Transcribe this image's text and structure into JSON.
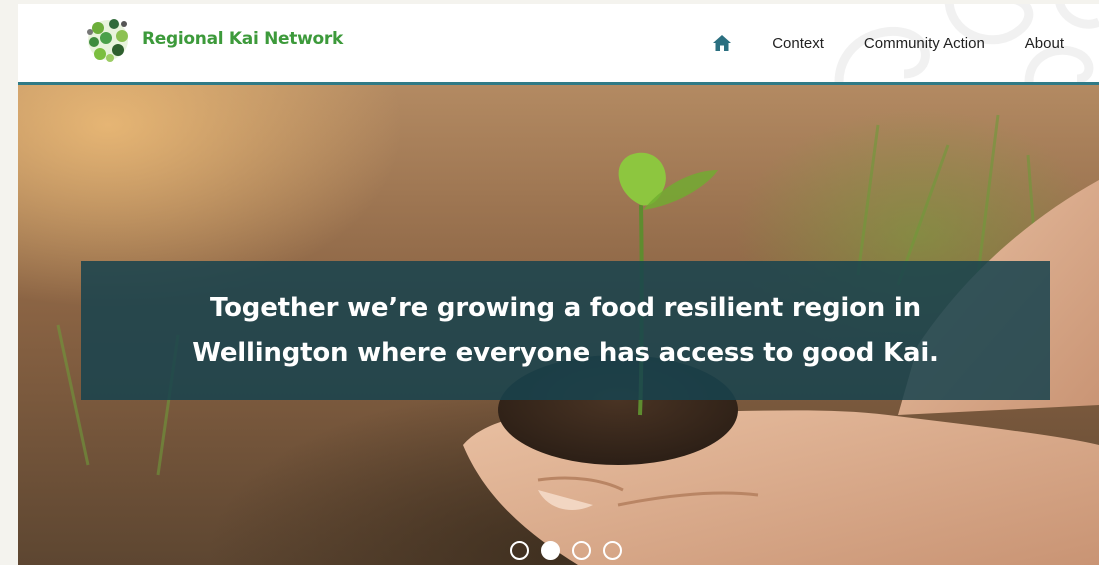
{
  "brand": {
    "name": "Regional Kai Network",
    "logo_icon": "vegetable-circle-logo-icon"
  },
  "nav": {
    "home_icon": "home-icon",
    "items": [
      {
        "label": "Context"
      },
      {
        "label": "Community Action"
      },
      {
        "label": "About"
      }
    ]
  },
  "hero": {
    "headline_line1": "Together we’re growing a food resilient region in",
    "headline_line2": "Wellington where everyone has access to good Kai.",
    "image": "hands-holding-soil-with-seedling",
    "carousel": {
      "total_slides": 4,
      "active_slide": 2
    }
  },
  "colors": {
    "brand_green": "#3d9a3b",
    "header_rule": "#2f7a86",
    "banner_bg": "#17424e",
    "home_icon": "#2b6f80"
  }
}
